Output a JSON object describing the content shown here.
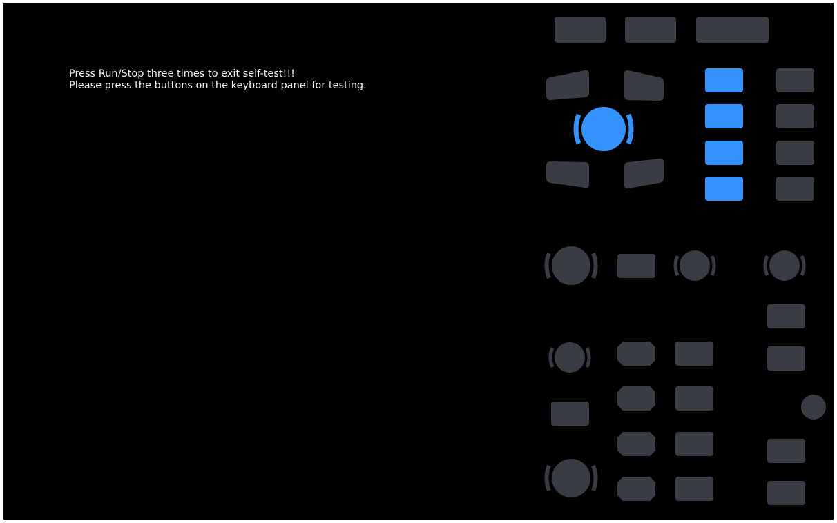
{
  "screen": {
    "instruction_line_1": "Press Run/Stop three times to exit self-test!!!",
    "instruction_line_2": "Please press the buttons on the keyboard panel for testing."
  },
  "colors": {
    "background": "#000000",
    "key_idle": "#3a3c43",
    "key_lit": "#3593fe",
    "text": "#f2f2f2"
  },
  "key_states": {
    "top_row": [
      "off",
      "off",
      "off"
    ],
    "nav_knob": "on",
    "nav_diagonals": [
      "off",
      "off",
      "off",
      "off"
    ],
    "column_a": [
      "on",
      "on",
      "on",
      "on"
    ],
    "column_b": [
      "off",
      "off",
      "off",
      "off"
    ]
  },
  "icons": {
    "knob": "rotary-knob-icon",
    "round_button": "round-button-icon"
  }
}
